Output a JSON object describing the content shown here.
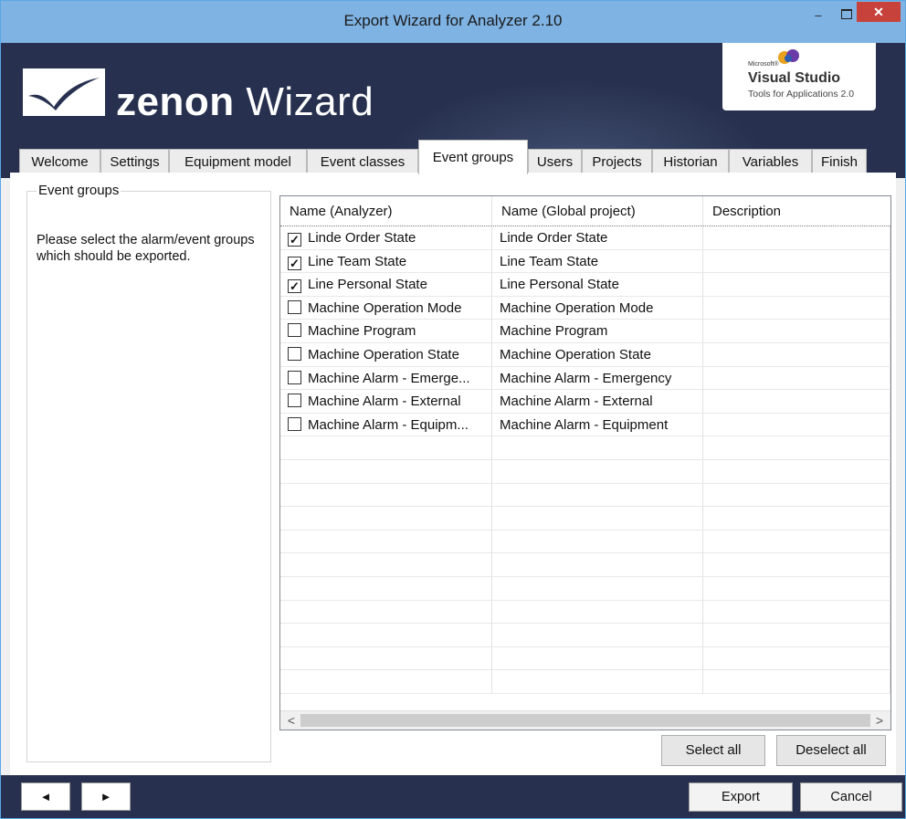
{
  "window": {
    "title": "Export Wizard for Analyzer 2.10",
    "minimize_glyph": "–",
    "close_glyph": "✕"
  },
  "banner": {
    "brand_bold": "zenon",
    "brand_rest": " Wizard",
    "vs_ms": "Microsoft®",
    "vs_name": "Visual Studio",
    "vs_sub": "Tools for Applications 2.0"
  },
  "tabs": [
    {
      "label": "Welcome"
    },
    {
      "label": "Settings"
    },
    {
      "label": "Equipment model"
    },
    {
      "label": "Event classes"
    },
    {
      "label": "Event groups",
      "active": true
    },
    {
      "label": "Users"
    },
    {
      "label": "Projects"
    },
    {
      "label": "Historian"
    },
    {
      "label": "Variables"
    },
    {
      "label": "Finish"
    }
  ],
  "group": {
    "title": "Event groups",
    "description": "Please select the alarm/event groups which should be exported."
  },
  "grid": {
    "columns": [
      "Name (Analyzer)",
      "Name (Global project)",
      "Description"
    ],
    "rows": [
      {
        "checked": true,
        "analyzer": "Linde Order State",
        "global": "Linde Order State",
        "description": ""
      },
      {
        "checked": true,
        "analyzer": "Line Team State",
        "global": "Line Team State",
        "description": ""
      },
      {
        "checked": true,
        "analyzer": "Line Personal State",
        "global": "Line Personal State",
        "description": ""
      },
      {
        "checked": false,
        "analyzer": "Machine Operation Mode",
        "global": "Machine Operation Mode",
        "description": ""
      },
      {
        "checked": false,
        "analyzer": "Machine Program",
        "global": "Machine Program",
        "description": ""
      },
      {
        "checked": false,
        "analyzer": "Machine Operation State",
        "global": "Machine Operation State",
        "description": ""
      },
      {
        "checked": false,
        "analyzer": "Machine Alarm - Emerge...",
        "global": "Machine Alarm - Emergency",
        "description": ""
      },
      {
        "checked": false,
        "analyzer": "Machine Alarm - External",
        "global": "Machine Alarm - External",
        "description": ""
      },
      {
        "checked": false,
        "analyzer": "Machine Alarm - Equipm...",
        "global": "Machine Alarm - Equipment",
        "description": ""
      }
    ],
    "scroll_left": "<",
    "scroll_right": ">"
  },
  "buttons": {
    "select_all": "Select all",
    "deselect_all": "Deselect all",
    "back": "◄",
    "forward": "►",
    "export": "Export",
    "cancel": "Cancel"
  },
  "colors": {
    "banner": "#27314f",
    "titlebar": "#7fb3e3",
    "close": "#c7423a"
  }
}
